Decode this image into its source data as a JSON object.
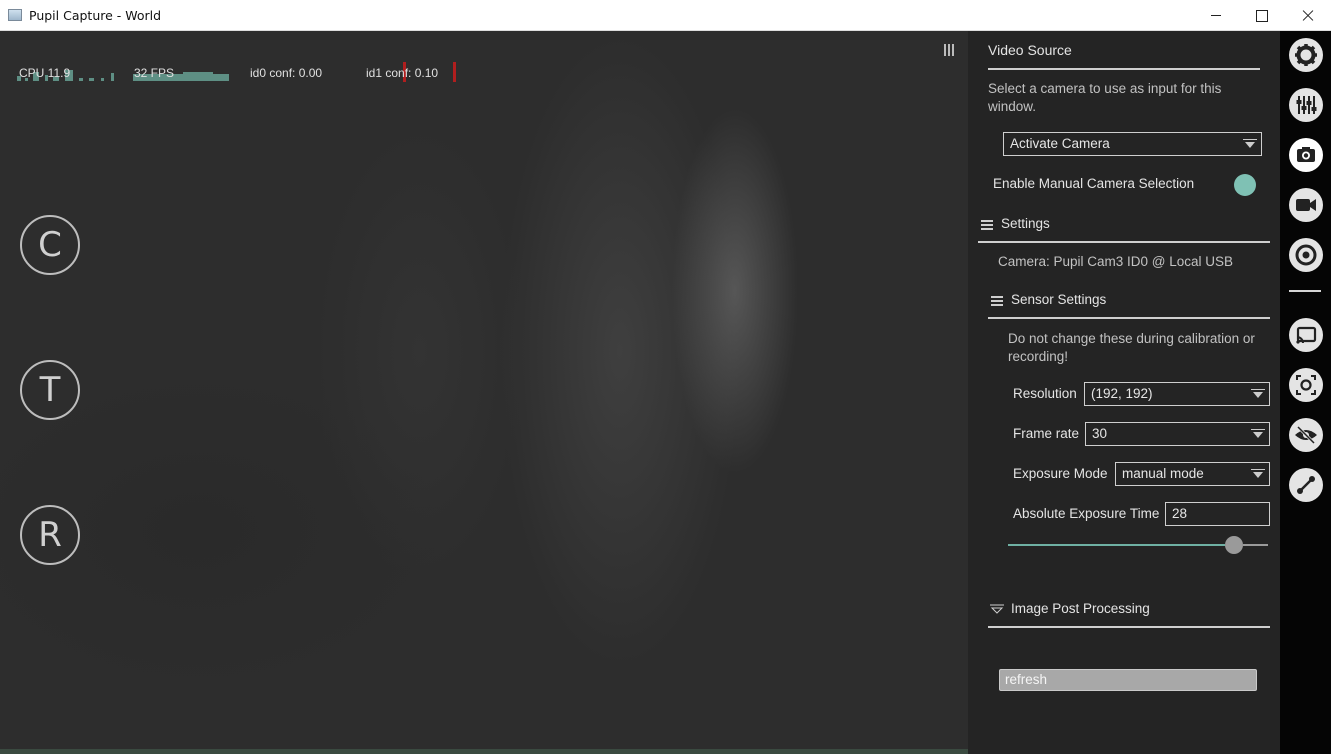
{
  "window": {
    "title": "Pupil Capture - World"
  },
  "hud": {
    "cpu_label": "CPU 11.9",
    "fps_label": "32 FPS",
    "id0_conf": "id0 conf: 0.00",
    "id1_conf": "id1 conf: 0.10",
    "graph_color": "#5e8f84",
    "conf_bar_color": "#b01e1e"
  },
  "side_buttons": [
    {
      "letter": "C"
    },
    {
      "letter": "T"
    },
    {
      "letter": "R"
    }
  ],
  "panel": {
    "video_source_title": "Video Source",
    "video_source_desc": "Select a camera to use as input for this window.",
    "activate_camera": "Activate Camera",
    "manual_selection_label": "Enable Manual Camera Selection",
    "settings_title": "Settings",
    "camera_info": "Camera: Pupil Cam3 ID0 @ Local USB",
    "sensor_settings_title": "Sensor Settings",
    "sensor_warning": "Do not change these during calibration or recording!",
    "resolution_label": "Resolution",
    "resolution_value": "(192, 192)",
    "frame_rate_label": "Frame rate",
    "frame_rate_value": "30",
    "exposure_mode_label": "Exposure Mode",
    "exposure_mode_value": "manual mode",
    "abs_exposure_label": "Absolute Exposure Time",
    "abs_exposure_value": "28",
    "abs_exposure_slider_fraction": 0.87,
    "image_post_title": "Image Post Processing",
    "refresh_label": "refresh",
    "accent_color": "#7fc1b4"
  },
  "iconbar": {
    "icons": [
      {
        "name": "gear-icon"
      },
      {
        "name": "sliders-icon"
      },
      {
        "name": "camera-icon",
        "active": true
      },
      {
        "name": "video-camera-icon"
      },
      {
        "name": "target-icon"
      },
      {
        "name": "cast-icon"
      },
      {
        "name": "focus-camera-icon"
      },
      {
        "name": "eye-slash-icon"
      },
      {
        "name": "link-icon"
      }
    ]
  }
}
